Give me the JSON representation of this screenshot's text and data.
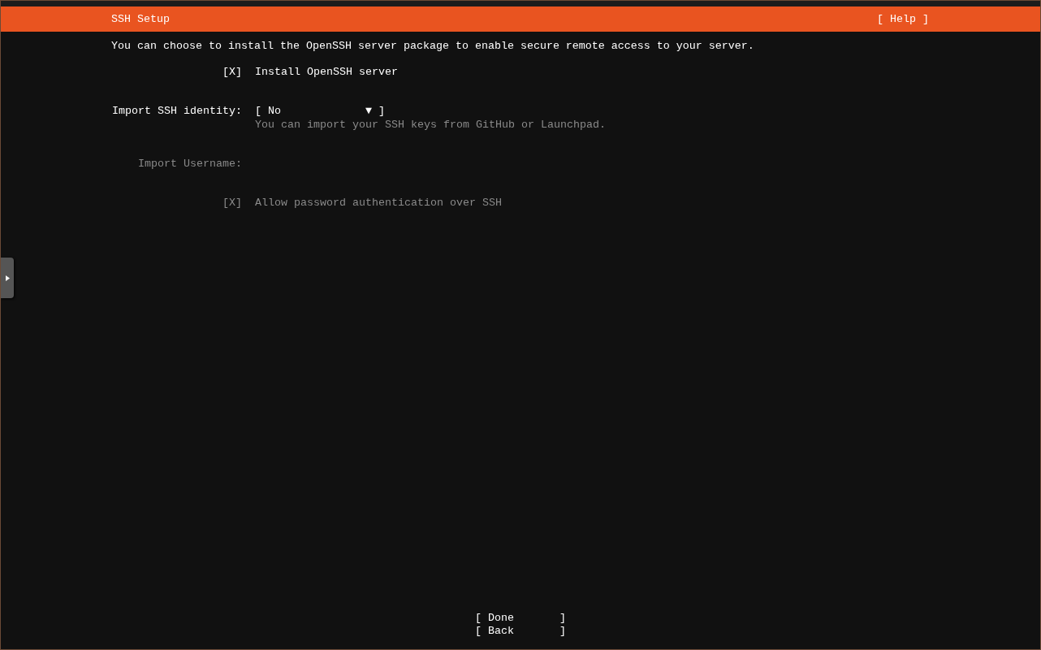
{
  "header": {
    "title": "SSH Setup",
    "help": "[ Help ]"
  },
  "intro": "You can choose to install the OpenSSH server package to enable secure remote access to your server.",
  "fields": [
    {
      "kind": "checkbox",
      "mark": "[X]",
      "label": "Install OpenSSH server",
      "checked": true,
      "disabled": false
    },
    {
      "kind": "dropdown",
      "label": "Import SSH identity:",
      "value": "[ No             ▼ ]",
      "hint": "You can import your SSH keys from GitHub or Launchpad.",
      "disabled": false
    },
    {
      "kind": "text",
      "label": "Import Username:",
      "disabled": true
    },
    {
      "kind": "checkbox",
      "mark": "[X]",
      "label": "Allow password authentication over SSH",
      "checked": true,
      "disabled": true
    }
  ],
  "buttons": [
    {
      "label": "[ Done       ]"
    },
    {
      "label": "[ Back       ]"
    }
  ]
}
